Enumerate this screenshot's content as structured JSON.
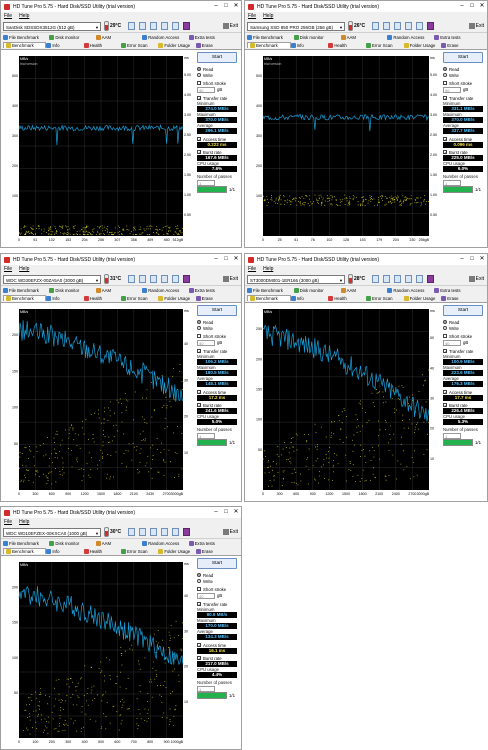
{
  "common": {
    "menu": [
      "File",
      "Help"
    ],
    "exit_label": "Exit",
    "tabs_row1": [
      "File Benchmark",
      "Disk monitor",
      "AAM",
      "Random Access",
      "Extra tests"
    ],
    "tabs_row2": [
      "Benchmark",
      "Info",
      "Health",
      "Error Scan",
      "Folder Usage",
      "Erase"
    ],
    "start_label": "Start",
    "read_label": "Read",
    "write_label": "Write",
    "short_stroke_label": "Short stroke",
    "short_stroke_value": "40",
    "short_stroke_unit": "gB",
    "transfer_rate_label": "Transfer rate",
    "minimum_label": "Minimum",
    "maximum_label": "Maximum",
    "average_label": "Average",
    "access_time_label": "Access time",
    "burst_rate_label": "Burst rate",
    "cpu_usage_label": "CPU usage",
    "passes_label": "Number of passes",
    "passes_value": "1",
    "passes_progress": "1/1",
    "colors": {
      "graph_bg": "#000000",
      "grid": "#3a3a3a",
      "transfer": "#1a9fd9",
      "access": "#d8d41a",
      "accent_red": "#d32a2a"
    },
    "icons": [
      "temperature-icon",
      "copy-icon",
      "copy-text-icon",
      "save-icon",
      "screenshot-icon",
      "options-icon",
      "download-icon",
      "exit-icon"
    ]
  },
  "windows": [
    {
      "title": "HD Tune Pro 5.75 - Hard Disk/SSD Utility (trial version)",
      "drive": "SanDisk SDSSDX3512G (512 gB)",
      "temp": "29°C",
      "left_unit": "MB/s",
      "right_unit": "ms",
      "trial_label": "trial version",
      "y_left_ticks": [
        "500",
        "400",
        "300",
        "200",
        "100"
      ],
      "y_right_ticks": [
        "5.00",
        "4.00",
        "3.00",
        "2.50",
        "2.00",
        "1.50",
        "1.00",
        "0.50"
      ],
      "x_ticks": [
        "0",
        "51",
        "102",
        "153",
        "204",
        "256",
        "307",
        "358",
        "409",
        "460",
        "512gB"
      ],
      "minimum": "274.0 MB/s",
      "maximum": "370.0 MB/s",
      "average": "296.1 MB/s",
      "access_time": "0.222 ms",
      "burst_rate": "167.6 MB/s",
      "cpu_usage": "7.6%",
      "transfer_level": 0.6,
      "access_level": 0.03,
      "curve": "flat"
    },
    {
      "title": "HD Tune Pro 5.75 - Hard Disk/SSD Utility (trial version)",
      "drive": "Samsung SSD 850 PRO 256GB (256 gB)",
      "temp": "26°C",
      "left_unit": "MB/s",
      "right_unit": "ms",
      "trial_label": "trial version",
      "y_left_ticks": [
        "500",
        "400",
        "300",
        "200",
        "100"
      ],
      "y_right_ticks": [
        "5.00",
        "4.00",
        "3.00",
        "2.50",
        "2.00",
        "1.50",
        "1.00",
        "0.50"
      ],
      "x_ticks": [
        "0",
        "25",
        "51",
        "76",
        "102",
        "128",
        "153",
        "179",
        "204",
        "230",
        "256gB"
      ],
      "minimum": "331.1 MB/s",
      "maximum": "370.0 MB/s",
      "average": "337.7 MB/s",
      "access_time": "0.096 ms",
      "burst_rate": "225.0 MB/s",
      "cpu_usage": "6.0%",
      "transfer_level": 0.66,
      "access_level": 0.2,
      "curve": "flat"
    },
    {
      "title": "HD Tune Pro 5.75 - Hard Disk/SSD Utility (trial version)",
      "drive": "WDC WD30EFZX-00ZA5A0 (3000 gB)",
      "temp": "31°C",
      "left_unit": "MB/s",
      "right_unit": "ms",
      "trial_label": "",
      "y_left_ticks": [
        "200",
        "150",
        "100",
        "50"
      ],
      "y_right_ticks": [
        "40",
        "30",
        "20",
        "10"
      ],
      "x_ticks": [
        "0",
        "300",
        "600",
        "900",
        "1200",
        "1500",
        "1800",
        "2100",
        "2430",
        "2700",
        "3000gB"
      ],
      "minimum": "106.2 MB/s",
      "maximum": "180.5 MB/s",
      "average": "148.1 MB/s",
      "access_time": "17.2 ms",
      "burst_rate": "241.6 MB/s",
      "cpu_usage": "5.0%",
      "transfer_level": 0.88,
      "access_level": 0.3,
      "curve": "decline",
      "decline_to": 0.52
    },
    {
      "title": "HD Tune Pro 5.75 - Hard Disk/SSD Utility (trial version)",
      "drive": "ST3000DM001-1ER166 (3000 gB)",
      "temp": "28°C",
      "left_unit": "MB/s",
      "right_unit": "ms",
      "trial_label": "",
      "y_left_ticks": [
        "250",
        "200",
        "150",
        "100",
        "50"
      ],
      "y_right_ticks": [
        "50",
        "40",
        "30",
        "20",
        "10"
      ],
      "x_ticks": [
        "0",
        "300",
        "600",
        "900",
        "1200",
        "1500",
        "1800",
        "2100",
        "2400",
        "2700",
        "3000gB"
      ],
      "minimum": "100.9 MB/s",
      "maximum": "223.6 MB/s",
      "average": "176.3 MB/s",
      "access_time": "17.7 ms",
      "burst_rate": "226.4 MB/s",
      "cpu_usage": "5.3%",
      "transfer_level": 0.86,
      "access_level": 0.35,
      "curve": "decline",
      "decline_to": 0.4
    },
    {
      "title": "HD Tune Pro 5.75 - Hard Disk/SSD Utility (trial version)",
      "drive": "WDC WD10EFZEX-00KXCA0 (1000 gB)",
      "temp": "30°C",
      "left_unit": "MB/s",
      "right_unit": "ms",
      "trial_label": "",
      "y_left_ticks": [
        "200",
        "150",
        "100",
        "50"
      ],
      "y_right_ticks": [
        "40",
        "30",
        "20",
        "10"
      ],
      "x_ticks": [
        "0",
        "100",
        "200",
        "300",
        "400",
        "500",
        "600",
        "700",
        "800",
        "900",
        "1000gB"
      ],
      "minimum": "80.9 MB/s",
      "maximum": "170.0 MB/s",
      "average": "134.3 MB/s",
      "access_time": "16.1 ms",
      "burst_rate": "217.0 MB/s",
      "cpu_usage": "4.4%",
      "transfer_level": 0.82,
      "access_level": 0.3,
      "curve": "decline",
      "decline_to": 0.42
    }
  ]
}
